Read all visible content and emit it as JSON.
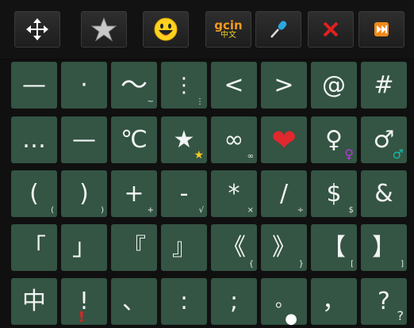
{
  "toolbar": {
    "buttons": [
      {
        "name": "move-icon-button",
        "icon": "move-arrows-icon"
      },
      {
        "name": "favorite-button",
        "icon": "star-icon"
      },
      {
        "name": "emoji-button",
        "icon": "smiley-icon"
      },
      {
        "name": "gcin-button",
        "icon": "gcin-logo-icon",
        "label_top": "gcin",
        "label_bottom": "中文"
      },
      {
        "name": "voice-input-button",
        "icon": "microphone-icon"
      },
      {
        "name": "close-button",
        "icon": "close-x-icon"
      },
      {
        "name": "next-button",
        "icon": "fast-forward-icon"
      }
    ]
  },
  "keys": [
    [
      {
        "main": "—",
        "sub": ""
      },
      {
        "main": "·",
        "sub": ""
      },
      {
        "main": "～",
        "sub": "~"
      },
      {
        "main": "⋮",
        "sub": "⋮"
      },
      {
        "main": "<",
        "sub": ""
      },
      {
        "main": ">",
        "sub": ""
      },
      {
        "main": "@",
        "sub": ""
      },
      {
        "main": "#",
        "sub": ""
      }
    ],
    [
      {
        "main": "…",
        "sub": ""
      },
      {
        "main": "—",
        "sub": ""
      },
      {
        "main": "℃",
        "sub": ""
      },
      {
        "main": "★",
        "sub": "★"
      },
      {
        "main": "∞",
        "sub": "∞"
      },
      {
        "main": "❤",
        "sub": ""
      },
      {
        "main": "♀",
        "sub": "♀"
      },
      {
        "main": "♂",
        "sub": "♂"
      }
    ],
    [
      {
        "main": "(",
        "sub": "("
      },
      {
        "main": ")",
        "sub": ")"
      },
      {
        "main": "+",
        "sub": "+"
      },
      {
        "main": "-",
        "sub": "√"
      },
      {
        "main": "*",
        "sub": "×"
      },
      {
        "main": "/",
        "sub": "÷"
      },
      {
        "main": "$",
        "sub": "$"
      },
      {
        "main": "&",
        "sub": ""
      }
    ],
    [
      {
        "main": "「",
        "sub": ""
      },
      {
        "main": "」",
        "sub": ""
      },
      {
        "main": "『",
        "sub": ""
      },
      {
        "main": "』",
        "sub": ""
      },
      {
        "main": "《",
        "sub": "{"
      },
      {
        "main": "》",
        "sub": "}"
      },
      {
        "main": "【",
        "sub": "["
      },
      {
        "main": "】",
        "sub": "]"
      }
    ],
    [
      {
        "main": "中",
        "sub": ""
      },
      {
        "main": "!",
        "sub": "!"
      },
      {
        "main": "、",
        "sub": ""
      },
      {
        "main": ":",
        "sub": ""
      },
      {
        "main": ";",
        "sub": ""
      },
      {
        "main": "。",
        "sub": "●"
      },
      {
        "main": "，",
        "sub": ""
      },
      {
        "main": "?",
        "sub": "?"
      }
    ]
  ],
  "colors": {
    "key_bg": "#345444",
    "toolbar_bg": "#121212",
    "heart": "#e0282d",
    "star_accent": "#f6c81e",
    "female_accent": "#b23bd8",
    "male_accent": "#18b8a8",
    "close_red": "#e02020",
    "ff_orange": "#f08a1a"
  }
}
